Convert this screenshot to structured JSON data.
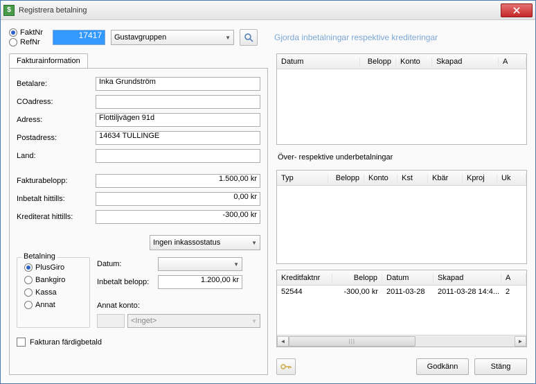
{
  "window": {
    "title": "Registrera betalning"
  },
  "top": {
    "faktnr_label": "FaktNr",
    "refnr_label": "RefNr",
    "faktnr_value": "17417",
    "group_combo": "Gustavgruppen",
    "info_text": "Gjorda inbetalningar respektive krediteringar"
  },
  "tab": {
    "label": "Fakturainformation"
  },
  "form": {
    "betalare_label": "Betalare:",
    "betalare": "Inka Grundström",
    "coadress_label": "COadress:",
    "coadress": "",
    "adress_label": "Adress:",
    "adress": "Flottiljvägen 91d",
    "postadress_label": "Postadress:",
    "postadress": "14634 TULLINGE",
    "land_label": "Land:",
    "land": "",
    "fakturabelopp_label": "Fakturabelopp:",
    "fakturabelopp": "1.500,00 kr",
    "inbetalt_label": "Inbetalt hittills:",
    "inbetalt": "0,00 kr",
    "krediterat_label": "Krediterat hittills:",
    "krediterat": "-300,00 kr",
    "status_combo": "Ingen inkassostatus"
  },
  "payment": {
    "group_label": "Betalning",
    "plusgiro": "PlusGiro",
    "bankgiro": "Bankgiro",
    "kassa": "Kassa",
    "annat": "Annat",
    "datum_label": "Datum:",
    "inbetalt_belopp_label": "Inbetalt belopp:",
    "inbetalt_belopp": "1.200,00 kr",
    "annat_konto_label": "Annat konto:",
    "konto_combo": "<Inget>"
  },
  "checkbox": {
    "label": "Fakturan färdigbetald"
  },
  "grid1": {
    "headers": [
      "Datum",
      "Belopp",
      "Konto",
      "Skapad",
      "A"
    ]
  },
  "section2_caption": "Över- respektive underbetalningar",
  "grid2": {
    "headers": [
      "Typ",
      "Belopp",
      "Konto",
      "Kst",
      "Kbär",
      "Kproj",
      "Uk"
    ]
  },
  "grid3": {
    "headers": [
      "Kreditfaktnr",
      "Belopp",
      "Datum",
      "Skapad",
      "A"
    ],
    "rows": [
      {
        "kreditfaktnr": "52544",
        "belopp": "-300,00 kr",
        "datum": "2011-03-28",
        "skapad": "2011-03-28 14:4...",
        "a": "2"
      }
    ]
  },
  "buttons": {
    "godkann": "Godkänn",
    "stang": "Stäng"
  }
}
